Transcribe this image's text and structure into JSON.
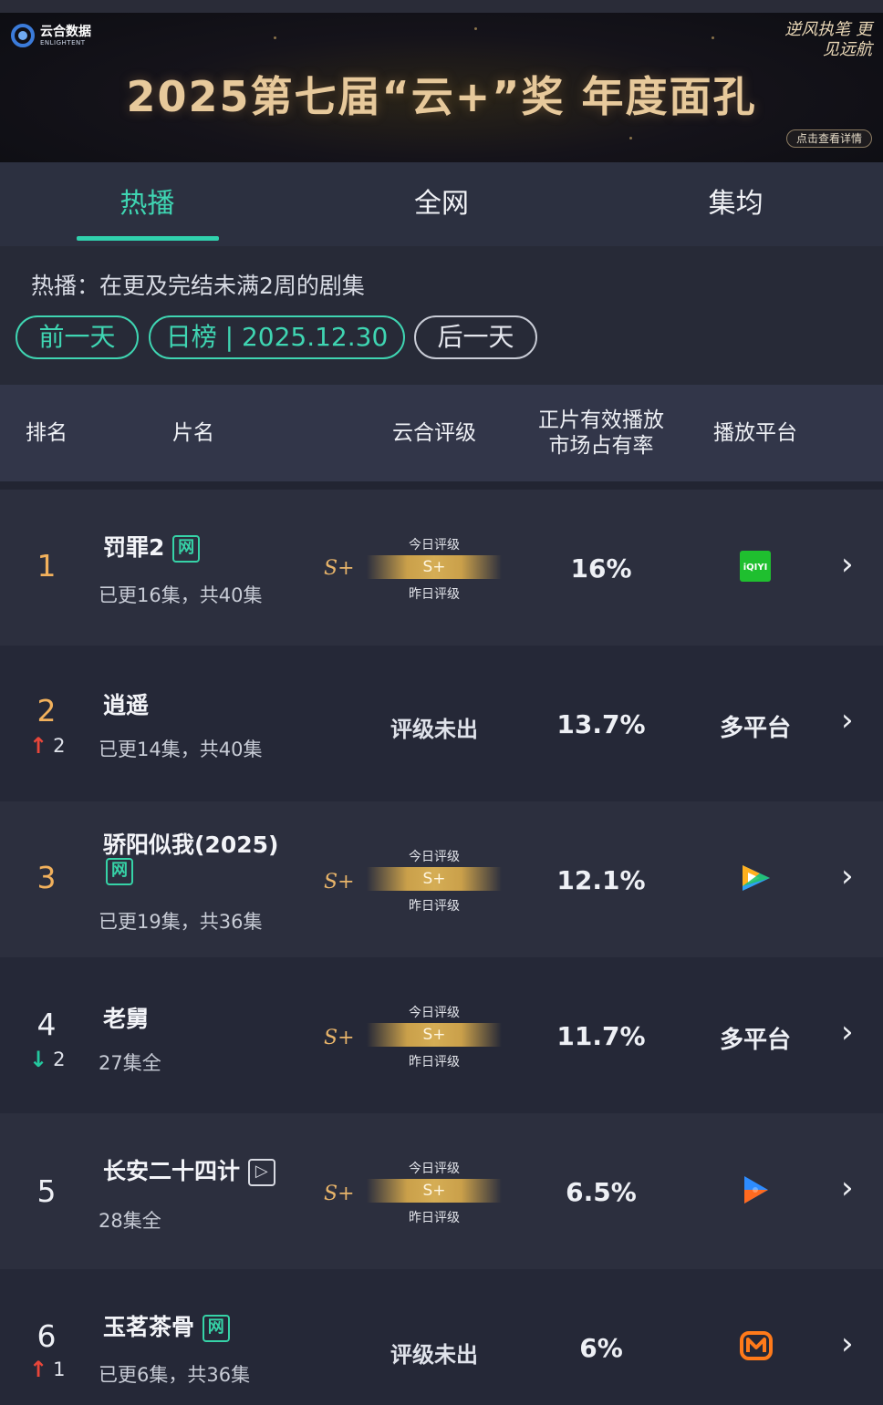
{
  "banner": {
    "logo_cn": "云合数据",
    "logo_en": "ENLIGHTENT",
    "title": "2025第七届“云+”奖  年度面孔",
    "slogan": "逆风执笔 更见远航",
    "detail_button": "点击查看详情"
  },
  "tabs": [
    {
      "label": "热播",
      "active": true
    },
    {
      "label": "全网",
      "active": false
    },
    {
      "label": "集均",
      "active": false
    }
  ],
  "filter": {
    "description": "热播：在更及完结未满2周的剧集",
    "prev_label": "前一天",
    "date_label": "日榜 | 2025.12.30",
    "next_label": "后一天"
  },
  "table": {
    "headers": {
      "rank": "排名",
      "title": "片名",
      "rating": "云合评级",
      "share_line1": "正片有效播放",
      "share_line2": "市场占有率",
      "platform": "播放平台"
    },
    "rating_today_label": "今日评级",
    "rating_yesterday_label": "昨日评级",
    "rows": [
      {
        "rank": "1",
        "title": "罚罪2",
        "badge": "网",
        "sub": "已更16集，共40集",
        "change": "",
        "change_dir": "",
        "prev_rating": "S+",
        "rating": "S+",
        "share": "16%",
        "platform": "",
        "platform_icon": "iqiyi-icon",
        "platform_icon_text": "iQIYI"
      },
      {
        "rank": "2",
        "title": "逍遥",
        "badge": "",
        "sub": "已更14集，共40集",
        "change": "2",
        "change_dir": "up",
        "prev_rating": "",
        "rating": "评级未出",
        "share": "13.7%",
        "platform": "多平台",
        "platform_icon": ""
      },
      {
        "rank": "3",
        "title": "骄阳似我(2025)",
        "badge": "网",
        "sub": "已更19集，共36集",
        "change": "",
        "change_dir": "",
        "prev_rating": "S+",
        "rating": "S+",
        "share": "12.1%",
        "platform": "",
        "platform_icon": "tencent-video-icon"
      },
      {
        "rank": "4",
        "title": "老舅",
        "badge": "",
        "sub": "27集全",
        "change": "2",
        "change_dir": "down",
        "prev_rating": "S+",
        "rating": "S+",
        "share": "11.7%",
        "platform": "多平台",
        "platform_icon": ""
      },
      {
        "rank": "5",
        "title": "长安二十四计",
        "badge": "play",
        "sub": "28集全",
        "change": "",
        "change_dir": "",
        "prev_rating": "S+",
        "rating": "S+",
        "share": "6.5%",
        "platform": "",
        "platform_icon": "youku-icon"
      },
      {
        "rank": "6",
        "title": "玉茗茶骨",
        "badge": "网",
        "sub": "已更6集，共36集",
        "change": "1",
        "change_dir": "up",
        "prev_rating": "",
        "rating": "评级未出",
        "share": "6%",
        "platform": "",
        "platform_icon": "mango-tv-icon"
      }
    ]
  },
  "colors": {
    "accent": "#3fd5b2",
    "gold": "#f2b15c",
    "up": "#e8463a",
    "down": "#24c79e"
  }
}
